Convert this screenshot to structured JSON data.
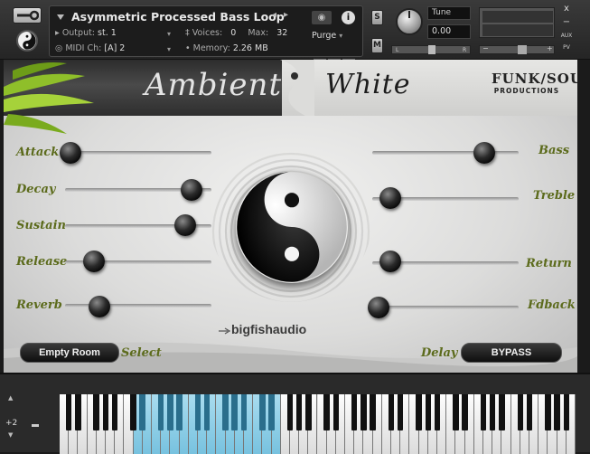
{
  "header": {
    "instrument_name": "Asymmetric Processed Bass Loop",
    "output_label": "Output:",
    "output_value": "st. 1",
    "voices_label": "Voices:",
    "voices_value": "0",
    "max_label": "Max:",
    "max_value": "32",
    "midi_label": "MIDI Ch:",
    "midi_value": "[A]  2",
    "memory_label": "Memory:",
    "memory_value": "2.26 MB",
    "purge_label": "Purge",
    "solo_label": "S",
    "mute_label": "M",
    "tune_label": "Tune",
    "tune_value": "0.00",
    "pan_left": "L",
    "pan_right": "R",
    "vol_minus": "−",
    "vol_plus": "+",
    "aux_label": "AUX",
    "pv_label": "PV",
    "close_symbol": "x",
    "minimize_symbol": "−",
    "info_symbol": "i",
    "nav_left": "◂",
    "nav_right": "▸",
    "dropdown_arrow": "▾"
  },
  "face": {
    "title_left": "Ambient",
    "title_right": "White",
    "logo_line1": "FUNK/SOUL",
    "logo_line2": "PRODUCTIONS",
    "brand": "bigfishaudio",
    "left_params": [
      {
        "label": "Attack",
        "level": 0.0
      },
      {
        "label": "Decay",
        "level": 0.9
      },
      {
        "label": "Sustain",
        "level": 0.85
      },
      {
        "label": "Release",
        "level": 0.22
      },
      {
        "label": "Reverb",
        "level": 0.25
      }
    ],
    "right_params": [
      {
        "label": "Bass",
        "level": 0.75
      },
      {
        "label": "Treble",
        "level": 0.05
      },
      {
        "label": "Return",
        "level": 0.05
      },
      {
        "label": "Fdback",
        "level": 0.0
      }
    ],
    "select_label": "Select",
    "select_value": "Empty Room",
    "delay_label": "Delay",
    "delay_value": "BYPASS"
  },
  "keyboard": {
    "octave_value": "+2",
    "octave_up_symbol": "▲",
    "octave_down_symbol": "▼"
  },
  "colors": {
    "label_green": "#5c6b1c",
    "key_highlight": "#8fd0ea"
  }
}
